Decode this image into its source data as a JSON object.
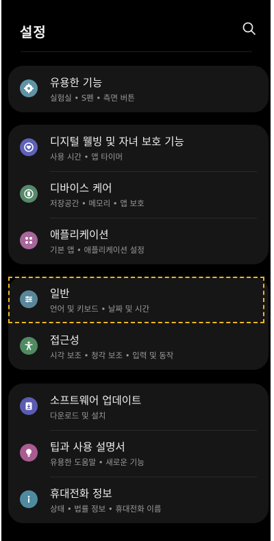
{
  "header": {
    "title": "설정",
    "search_icon": "search-icon"
  },
  "items": [
    {
      "title": "유용한 기능",
      "subtitle": "실험실 • S펜 • 측면 버튼",
      "icon": "plus-gear-icon",
      "color": "#5f93a6"
    },
    {
      "title": "디지털 웰빙 및 자녀 보호 기능",
      "subtitle": "사용 시간 • 앱 타이머",
      "icon": "heart-circle-icon",
      "color": "#5d62b8"
    },
    {
      "title": "디바이스 케어",
      "subtitle": "저장공간 • 메모리 • 앱 보호",
      "icon": "battery-icon",
      "color": "#57886b"
    },
    {
      "title": "애플리케이션",
      "subtitle": "기본 앱 • 애플리케이션 설정",
      "icon": "grid-dots-icon",
      "color": "#a7679a"
    },
    {
      "title": "일반",
      "subtitle": "언어 및 키보드 • 날짜 및 시간",
      "icon": "sliders-icon",
      "color": "#5a8699"
    },
    {
      "title": "접근성",
      "subtitle": "시각 보조 • 청각 보조 • 입력 및 동작",
      "icon": "person-icon",
      "color": "#4f8a61"
    },
    {
      "title": "소프트웨어 업데이트",
      "subtitle": "다운로드 및 설치",
      "icon": "download-icon",
      "color": "#5b5bb2"
    },
    {
      "title": "팁과 사용 설명서",
      "subtitle": "유용한 도움말 • 새로운 기능",
      "icon": "bulb-icon",
      "color": "#a85c91"
    },
    {
      "title": "휴대전화 정보",
      "subtitle": "상태 • 법률 정보 • 휴대전화 이름",
      "icon": "info-icon",
      "color": "#4f8aa0"
    }
  ],
  "highlight_color": "#f2b821"
}
